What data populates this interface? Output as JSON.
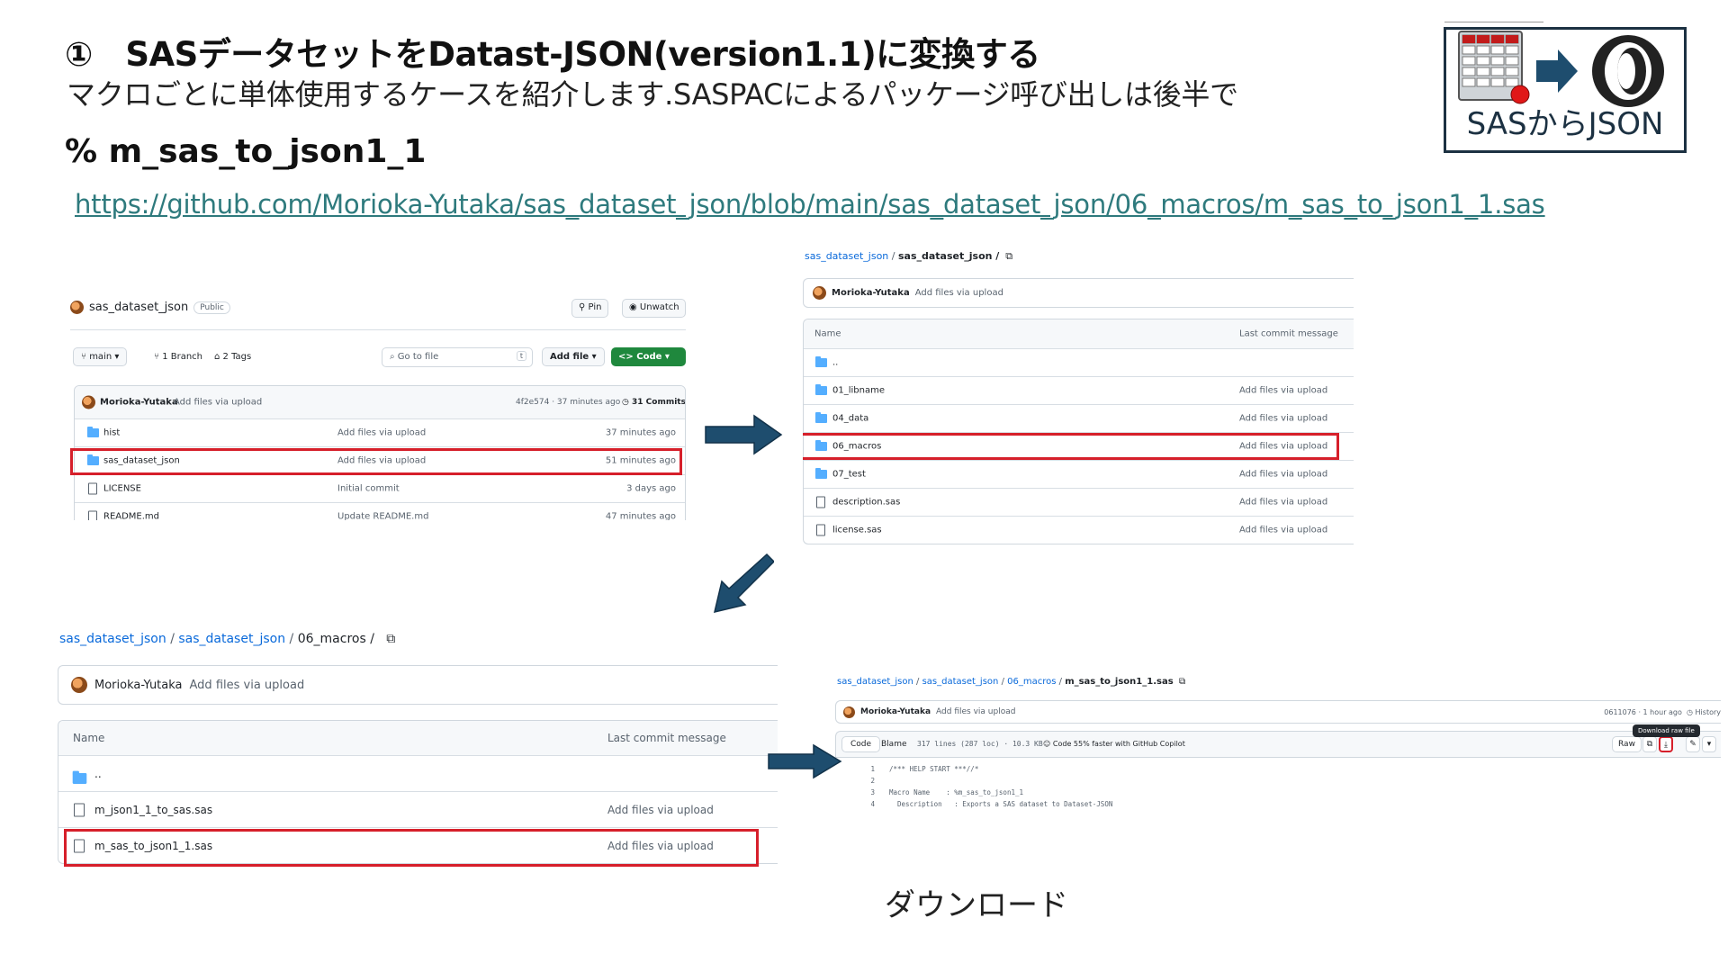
{
  "slide": {
    "title": "①　SASデータセットをDatast-JSON(version1.1)に変換する",
    "subtitle": "マクロごとに単体使用するケースを紹介します.SASPACによるパッケージ呼び出しは後半で",
    "macro_name": "% m_sas_to_json1_1",
    "macro_url": "https://github.com/Morioka-Yutaka/sas_dataset_json/blob/main/sas_dataset_json/06_macros/m_sas_to_json1_1.sas",
    "logo_text": "SASからJSON",
    "download_label": "ダウンロード"
  },
  "colors": {
    "arrow": "#1e4d6e",
    "highlight": "#d61f2a",
    "link": "#0969da",
    "url": "#2e7a7d",
    "code_button": "#1f883d",
    "folder": "#54aeff"
  },
  "panel1": {
    "repo_name": "sas_dataset_json",
    "visibility": "Public",
    "pin_label": "Pin",
    "unwatch_label": "Unwatch",
    "branch": "main",
    "branches": "1 Branch",
    "tags": "2 Tags",
    "goto_placeholder": "Go to file",
    "goto_key": "t",
    "addfile_label": "Add file",
    "code_label": "Code",
    "commit_author": "Morioka-Yutaka",
    "commit_message": "Add files via upload",
    "commit_meta": "4f2e574 · 37 minutes ago",
    "commits_count": "31 Commits",
    "rows": [
      {
        "name": "hist",
        "type": "folder",
        "message": "Add files via upload",
        "time": "37 minutes ago"
      },
      {
        "name": "sas_dataset_json",
        "type": "folder",
        "message": "Add files via upload",
        "time": "51 minutes ago"
      },
      {
        "name": "LICENSE",
        "type": "file",
        "message": "Initial commit",
        "time": "3 days ago"
      },
      {
        "name": "README.md",
        "type": "file",
        "message": "Update README.md",
        "time": "47 minutes ago"
      }
    ]
  },
  "panel2": {
    "crumb_root": "sas_dataset_json",
    "crumb_current": "sas_dataset_json /",
    "commit_author": "Morioka-Yutaka",
    "commit_message": "Add files via upload",
    "col_name": "Name",
    "col_message": "Last commit message",
    "rows": [
      {
        "name": "..",
        "type": "folder",
        "message": ""
      },
      {
        "name": "01_libname",
        "type": "folder",
        "message": "Add files via upload"
      },
      {
        "name": "04_data",
        "type": "folder",
        "message": "Add files via upload"
      },
      {
        "name": "06_macros",
        "type": "folder",
        "message": "Add files via upload"
      },
      {
        "name": "07_test",
        "type": "folder",
        "message": "Add files via upload"
      },
      {
        "name": "description.sas",
        "type": "file",
        "message": "Add files via upload"
      },
      {
        "name": "license.sas",
        "type": "file",
        "message": "Add files via upload"
      }
    ]
  },
  "panel3": {
    "crumb_root": "sas_dataset_json",
    "crumb_mid": "sas_dataset_json",
    "crumb_current": "06_macros /",
    "commit_author": "Morioka-Yutaka",
    "commit_message": "Add files via upload",
    "col_name": "Name",
    "col_message": "Last commit message",
    "rows": [
      {
        "name": "..",
        "type": "folder",
        "message": ""
      },
      {
        "name": "m_json1_1_to_sas.sas",
        "type": "file",
        "message": "Add files via upload"
      },
      {
        "name": "m_sas_to_json1_1.sas",
        "type": "file",
        "message": "Add files via upload"
      }
    ]
  },
  "panel4": {
    "crumb_root": "sas_dataset_json",
    "crumb_mid": "sas_dataset_json",
    "crumb_folder": "06_macros",
    "crumb_file": "m_sas_to_json1_1.sas",
    "commit_author": "Morioka-Yutaka",
    "commit_message": "Add files via upload",
    "commit_meta": "0611076 · 1 hour ago",
    "history_label": "History",
    "tab_code": "Code",
    "tab_blame": "Blame",
    "file_info": "317 lines (287 loc) · 10.3 KB",
    "copilot_text": "Code 55% faster with GitHub Copilot",
    "raw_label": "Raw",
    "tooltip": "Download raw file",
    "code_lines": [
      {
        "ln": "1",
        "text": "/*** HELP START ***//*"
      },
      {
        "ln": "2",
        "text": ""
      },
      {
        "ln": "3",
        "text": "Macro Name    : %m_sas_to_json1_1"
      },
      {
        "ln": "4",
        "text": "  Description   : Exports a SAS dataset to Dataset-JSON"
      }
    ]
  }
}
